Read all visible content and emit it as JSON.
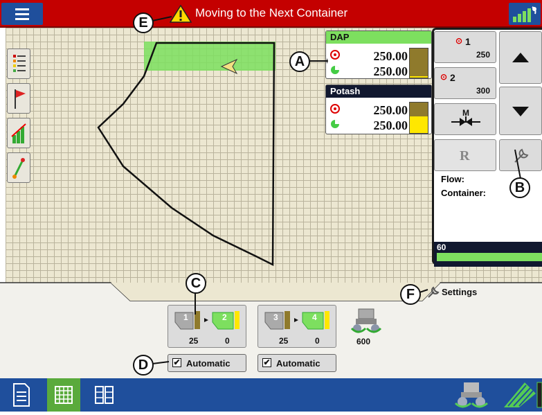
{
  "status_bar": {
    "alert_text": "Moving to the Next Container",
    "colors": {
      "alert_bg": "#c40000",
      "accent_blue": "#1f4f9c"
    }
  },
  "products": [
    {
      "name": "DAP",
      "header_color": "#7ddf5f",
      "target_rate": "250.00",
      "actual_rate": "250.00",
      "container_level": 0.05
    },
    {
      "name": "Potash",
      "header_color": "#11182f",
      "target_rate": "250.00",
      "actual_rate": "250.00",
      "container_level": 0.55
    }
  ],
  "rate_panel": {
    "rates": [
      {
        "label": "1",
        "value": "250"
      },
      {
        "label": "2",
        "value": "300"
      }
    ],
    "manual_label": "M",
    "rx_label": "R",
    "flow_label": "Flow:",
    "container_label": "Container:",
    "speed_value": "60"
  },
  "bottom": {
    "settings_label": "Settings",
    "product_groups": [
      {
        "bin_a": "1",
        "bin_b": "2",
        "count_a": "25",
        "count_b": "0"
      },
      {
        "bin_a": "3",
        "bin_b": "4",
        "count_a": "25",
        "count_b": "0"
      }
    ],
    "auto_buttons": [
      {
        "label": "Automatic",
        "checked": true
      },
      {
        "label": "Automatic",
        "checked": true
      }
    ],
    "meter_value": "600"
  },
  "callouts": [
    "A",
    "B",
    "C",
    "D",
    "E",
    "F"
  ],
  "icons": [
    "menu-icon",
    "warning-icon",
    "gps-satellite-icon",
    "layers-icon",
    "flag-icon",
    "chart-icon",
    "guidance-icon",
    "wrench-icon",
    "up-arrow-icon",
    "down-arrow-icon",
    "document-icon",
    "grid-icon",
    "split-grid-icon",
    "implement-icon",
    "field-icon"
  ]
}
